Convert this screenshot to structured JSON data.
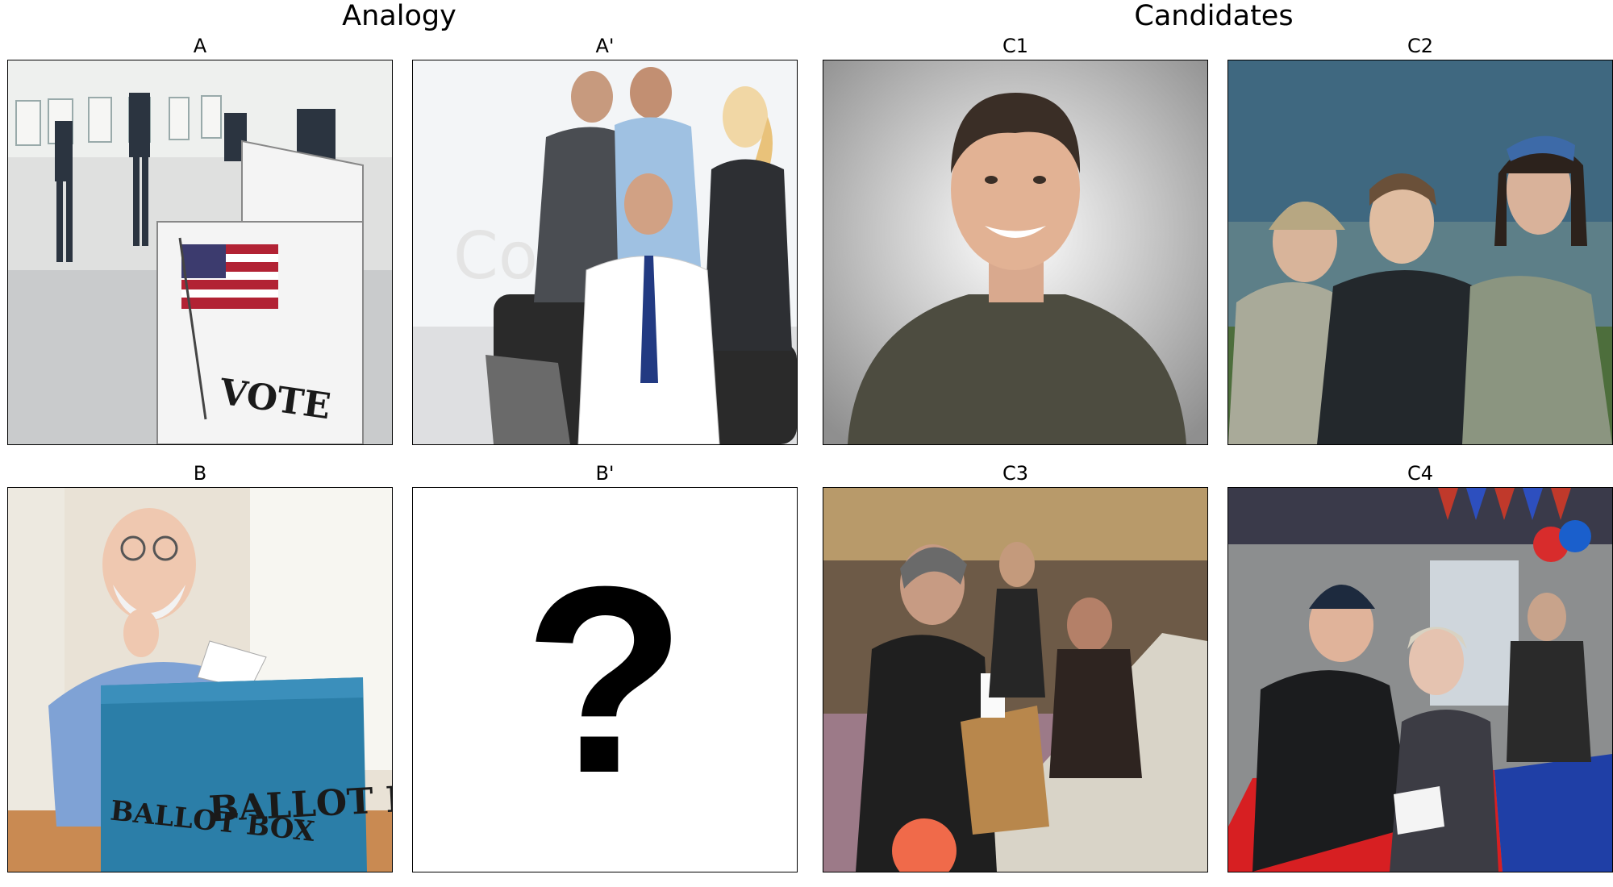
{
  "headers": {
    "analogy": "Analogy",
    "candidates": "Candidates"
  },
  "panels": {
    "a": {
      "label": "A",
      "sign_text": "VOTE",
      "image": "voters-at-polling-booths-with-vote-sign"
    },
    "a_prime": {
      "label": "A'",
      "watermark": "Colourbox",
      "image": "office-team-gathered-around-seated-businessman"
    },
    "b": {
      "label": "B",
      "box_text": "BALLOT BOX",
      "image": "elderly-man-thumbs-up-at-blue-ballot-box"
    },
    "b_prime": {
      "label": "B'",
      "symbol": "?"
    },
    "c1": {
      "label": "C1",
      "image": "smiling-man-portrait-olive-shirt"
    },
    "c2": {
      "label": "C2",
      "image": "three-young-men-outdoors"
    },
    "c3": {
      "label": "C3",
      "image": "people-casting-ballots-in-hall"
    },
    "c4": {
      "label": "C4",
      "image": "elderly-couple-voting-red-ballot-box"
    }
  }
}
